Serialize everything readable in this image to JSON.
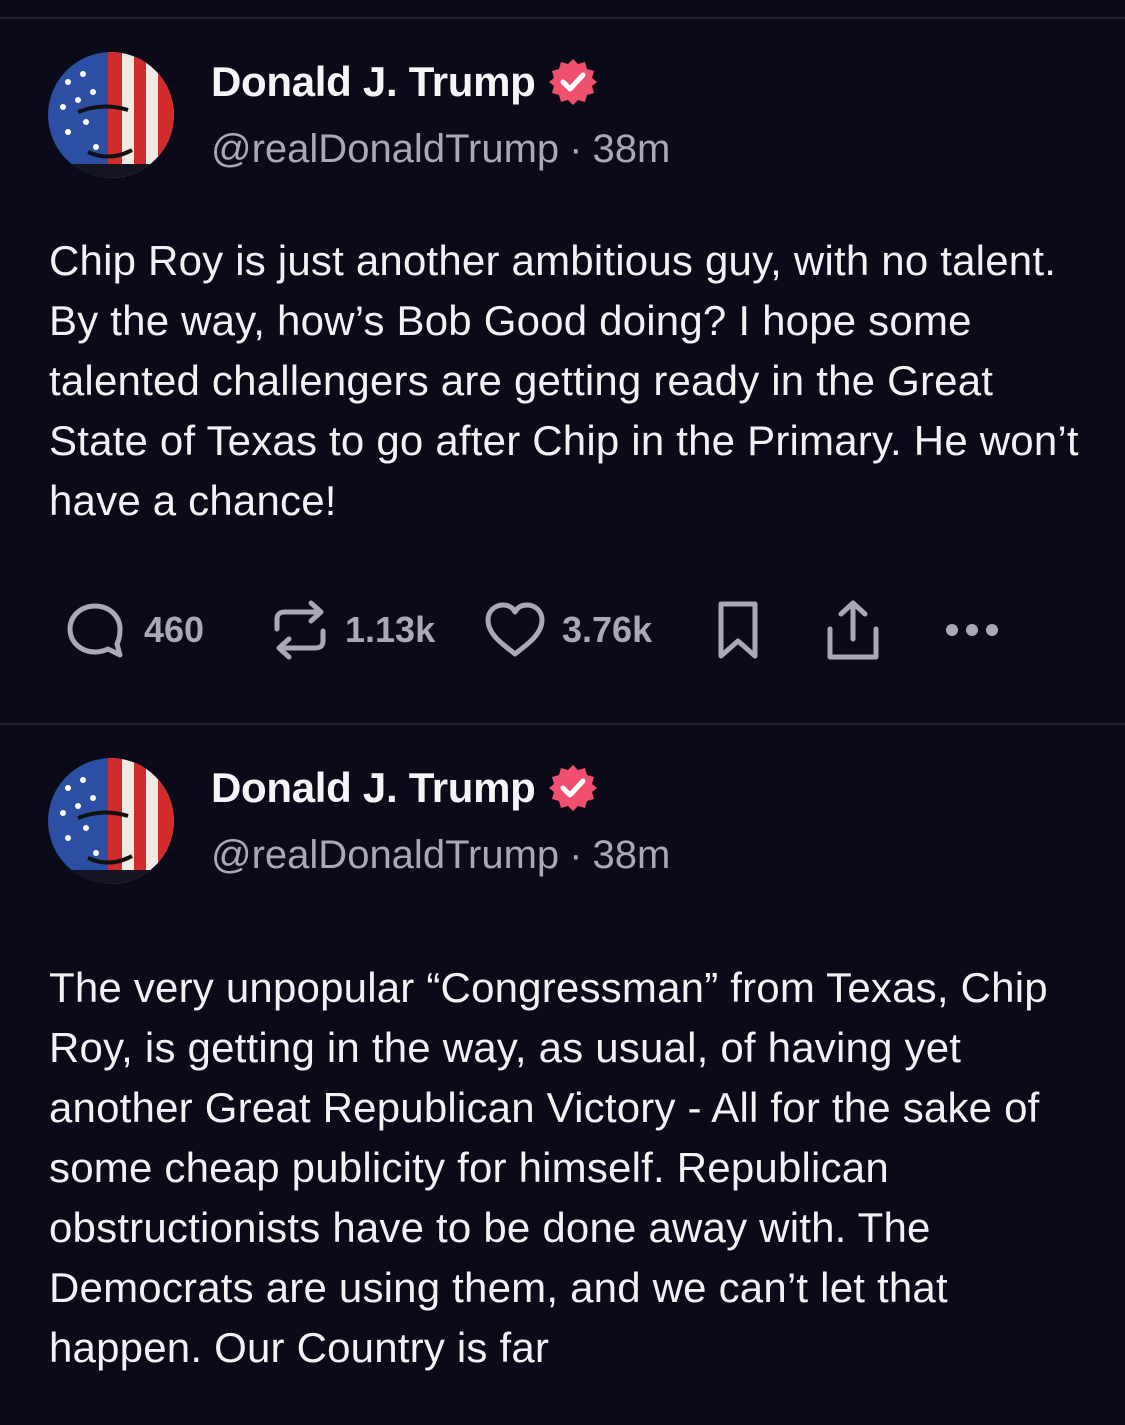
{
  "posts": [
    {
      "author": "Donald J. Trump",
      "handle": "@realDonaldTrump",
      "separator": "·",
      "time": "38m",
      "text": "Chip Roy is just another ambitious guy, with no talent. By the way, how’s Bob Good doing? I hope some talented challengers are getting ready in the Great State of Texas to go after Chip in the Primary. He won’t have a chance!",
      "replies": "460",
      "retruths": "1.13k",
      "likes": "3.76k"
    },
    {
      "author": "Donald J. Trump",
      "handle": "@realDonaldTrump",
      "separator": "·",
      "time": "38m",
      "text": "The very unpopular “Congressman” from Texas, Chip Roy, is getting in the way, as usual, of having yet another Great Republican Victory - All for the sake of some cheap publicity for himself. Republican obstructionists have to be done away with. The Democrats are using them, and we can’t let that happen. Our Country is far"
    }
  ],
  "colors": {
    "background": "#0b0a18",
    "verified_badge": "#f0506e",
    "muted_text": "#a9a8b5"
  },
  "icons": [
    "verified-badge-icon",
    "reply-icon",
    "retruth-icon",
    "heart-icon",
    "bookmark-icon",
    "share-icon",
    "more-icon"
  ]
}
